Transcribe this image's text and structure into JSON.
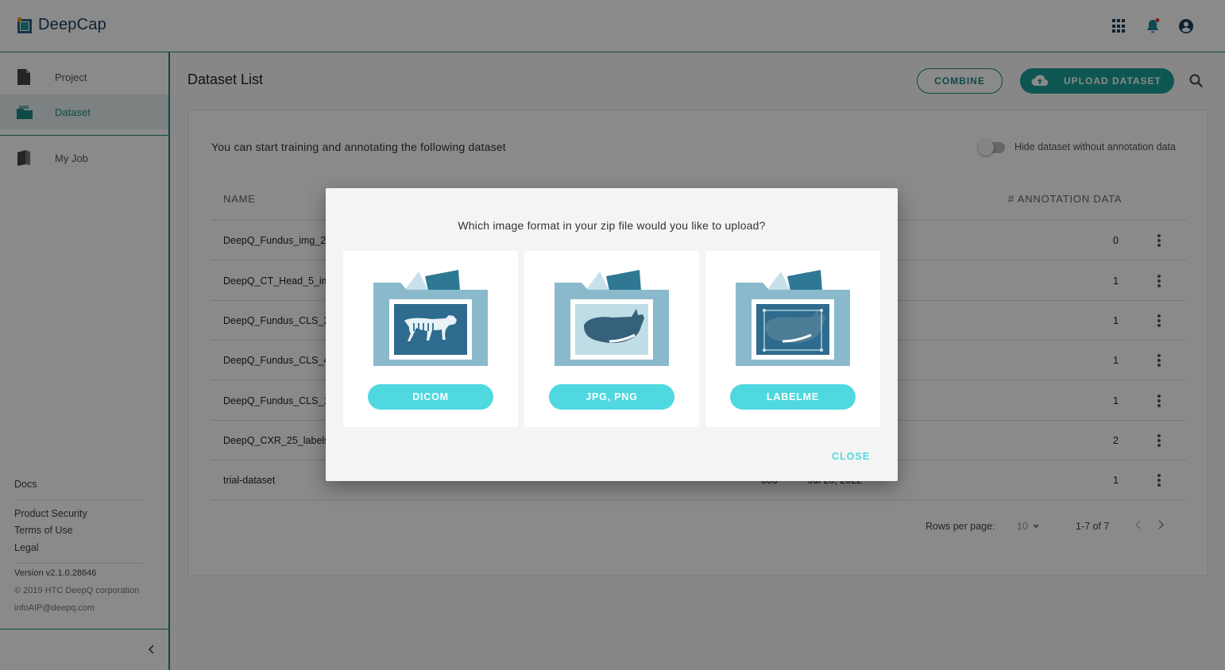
{
  "app": {
    "name": "DeepCap"
  },
  "sidebar": {
    "items": [
      {
        "label": "Project"
      },
      {
        "label": "Dataset"
      },
      {
        "label": "My Job"
      }
    ],
    "footer": {
      "docs": "Docs",
      "product_security": "Product Security",
      "terms": "Terms of Use",
      "legal": "Legal",
      "version": "Version v2.1.0.28646",
      "copyright": "© 2019 HTC DeepQ corporation",
      "email": "infoAIP@deepq.com"
    }
  },
  "page": {
    "title": "Dataset List",
    "combine_label": "COMBINE",
    "upload_label": "UPLOAD DATASET",
    "intro": "You can start training and annotating the following dataset",
    "toggle_label": "Hide dataset without annotation data"
  },
  "table": {
    "columns": {
      "name": "NAME",
      "annotation": "# ANNOTATION DATA"
    },
    "rows": [
      {
        "name": "DeepQ_Fundus_img_2",
        "count": "0"
      },
      {
        "name": "DeepQ_CT_Head_5_im",
        "count": "1"
      },
      {
        "name": "DeepQ_Fundus_CLS_2",
        "count": "1"
      },
      {
        "name": "DeepQ_Fundus_CLS_4",
        "count": "1"
      },
      {
        "name": "DeepQ_Fundus_CLS_1",
        "count": "1"
      },
      {
        "name": "DeepQ_CXR_25_labels",
        "count": "2"
      },
      {
        "name": "trial-dataset",
        "a": "000",
        "b": "Jul 20, 2022",
        "count": "1"
      }
    ]
  },
  "pagination": {
    "rows_label": "Rows per page:",
    "rows_value": "10",
    "range": "1-7 of 7"
  },
  "dialog": {
    "question": "Which image format in your zip file would you like to upload?",
    "options": [
      {
        "label": "DICOM"
      },
      {
        "label": "JPG, PNG"
      },
      {
        "label": "LABELME"
      }
    ],
    "close_label": "CLOSE"
  },
  "colors": {
    "accent": "#1a8a83",
    "dialog_button": "#4fd8e0"
  }
}
